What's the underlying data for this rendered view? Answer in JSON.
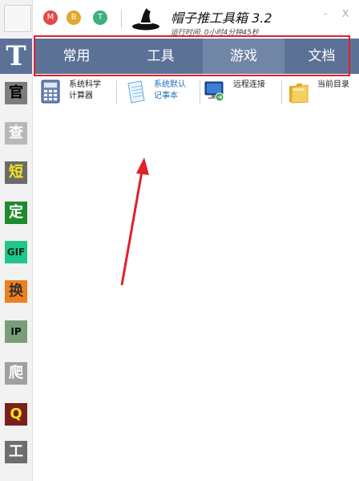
{
  "header": {
    "circles": [
      {
        "letter": "M",
        "color": "#e24a4a"
      },
      {
        "letter": "B",
        "color": "#e3a72a"
      },
      {
        "letter": "T",
        "color": "#3bb07e"
      }
    ],
    "title": "帽子推工具箱 3.2",
    "runtime": "运行时间: 0小时4分钟45秒",
    "minimize": "-",
    "close": "X"
  },
  "sidebar": {
    "top_letter": "T",
    "items": [
      {
        "label": "官",
        "bg": "#7d7d7d",
        "fg": "#000000"
      },
      {
        "label": "查",
        "bg": "#b8b8b8",
        "fg": "#ffffff"
      },
      {
        "label": "短",
        "bg": "#6b6b6b",
        "fg": "#f4e51a"
      },
      {
        "label": "定",
        "bg": "#1e8b2f",
        "fg": "#ffffff"
      },
      {
        "label": "GIF",
        "bg": "#20c78a",
        "fg": "#0a2a1a"
      },
      {
        "label": "换",
        "bg": "#f0801e",
        "fg": "#333333"
      },
      {
        "label": "IP",
        "bg": "#7a9e7a",
        "fg": "#0b0b0b"
      },
      {
        "label": "爬",
        "bg": "#a0a0a0",
        "fg": "#ffffff"
      },
      {
        "label": "Q",
        "bg": "#7a1f1f",
        "fg": "#f4e51a"
      },
      {
        "label": "工",
        "bg": "#6e6e6e",
        "fg": "#ffffff"
      }
    ]
  },
  "tabs": [
    {
      "label": "常用",
      "active": false
    },
    {
      "label": "工具",
      "active": false
    },
    {
      "label": "游戏",
      "active": true
    },
    {
      "label": "文档",
      "active": false
    }
  ],
  "tools": [
    {
      "line1": "系统科学",
      "line2": "计算器",
      "icon": "calculator-icon"
    },
    {
      "line1": "系统默认",
      "line2": "记事本",
      "icon": "notepad-icon"
    },
    {
      "line1": "远程连接",
      "line2": "",
      "icon": "remote-desktop-icon"
    },
    {
      "line1": "当前目录",
      "line2": "",
      "icon": "folder-icon"
    }
  ]
}
